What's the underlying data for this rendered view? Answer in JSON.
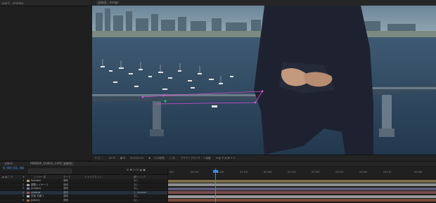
{
  "left_panel": {
    "title": "plan1 : shadow"
  },
  "comp_tabs": [
    "plan1",
    "bridge"
  ],
  "viewer_toolbar": {
    "zoom": "50 %",
    "timecode": "0;00;01;10",
    "resolution": "(1/2画質)",
    "camera": "アクティブカメラ",
    "view": "1 画面"
  },
  "timeline": {
    "tabs": [
      "plan1",
      "RENDER_QUEUE_CARDS",
      "plan1"
    ],
    "timecode": "0;00;01;06",
    "columns": {
      "layer_name": "レイヤー名",
      "mode": "モード",
      "trkmat": "トラックマット",
      "parent": "親とリンク"
    },
    "layers": [
      {
        "num": "1",
        "name": "Speaker",
        "mode": "通常",
        "parent": "なし",
        "label": "#b0a060"
      },
      {
        "num": "2",
        "name": "調整レイヤー 2",
        "mode": "通常",
        "parent": "なし",
        "label": "#a0a0a0"
      },
      {
        "num": "3",
        "name": "[bridge]",
        "mode": "通常",
        "parent": "なし",
        "label": "#7a7aa8"
      },
      {
        "num": "4",
        "name": "shadow",
        "mode": "通常",
        "parent": "1. Speaker",
        "label": "#a05050"
      },
      {
        "num": "5",
        "name": "白色 平面 1",
        "mode": "通常",
        "parent": "なし",
        "label": "#c0c0c0"
      },
      {
        "num": "6",
        "name": "[plan1]",
        "mode": "通常",
        "parent": "なし",
        "label": "#a06040"
      }
    ],
    "ruler_ticks": [
      "00s",
      "00:15f",
      "01:00f",
      "01:15f",
      "02:00f",
      "02:15f",
      "03:00f",
      "03:15f",
      "04:00f",
      "04:15f",
      "05:00f"
    ],
    "track_colors": [
      "#7d6f4a",
      "#8f8f8f",
      "#5d5d78",
      "#7a4d4d",
      "#9a9a9a",
      "#7a4a3a"
    ]
  }
}
